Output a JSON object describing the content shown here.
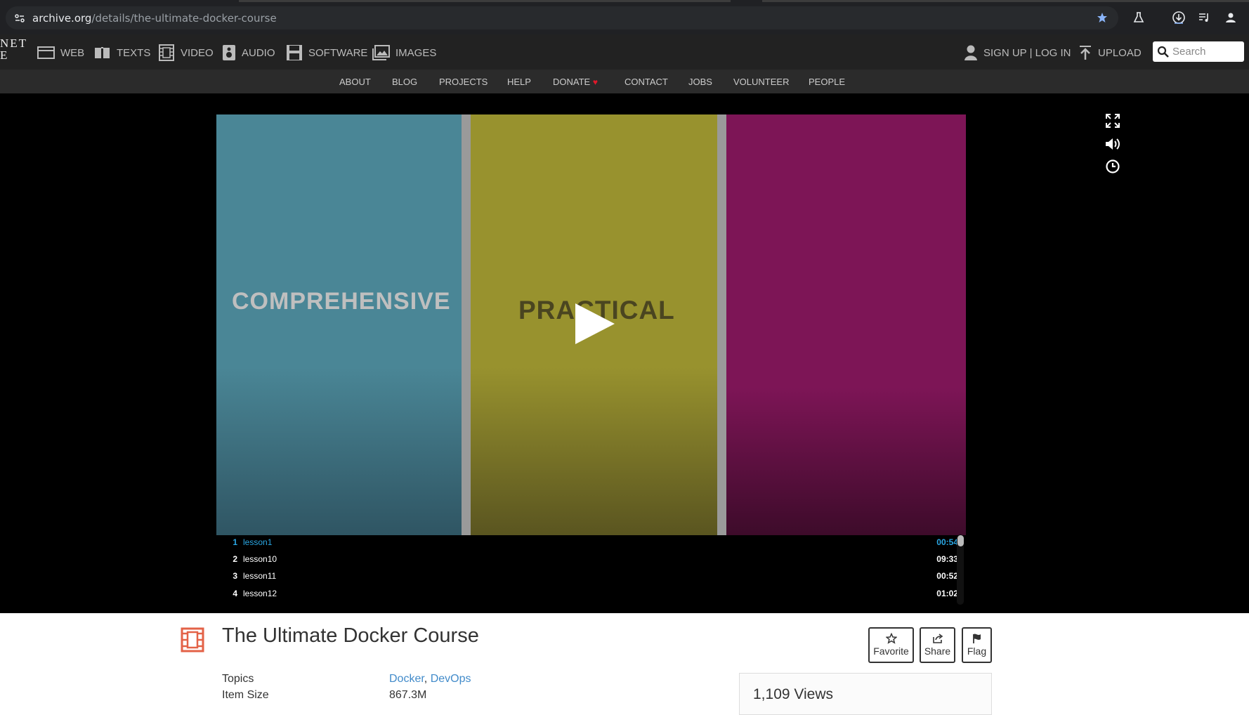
{
  "browser": {
    "url_domain": "archive.org",
    "url_path": "/details/the-ultimate-docker-course",
    "icons": [
      "site-settings-icon",
      "bookmark-star-icon",
      "labs-flask-icon",
      "download-icon",
      "media-queue-icon",
      "profile-icon"
    ]
  },
  "ia_nav": {
    "logo_lines": [
      "NET",
      "E"
    ],
    "items": [
      {
        "label": "WEB",
        "icon": "web-icon"
      },
      {
        "label": "TEXTS",
        "icon": "book-icon"
      },
      {
        "label": "VIDEO",
        "icon": "film-icon"
      },
      {
        "label": "AUDIO",
        "icon": "speaker-icon"
      },
      {
        "label": "SOFTWARE",
        "icon": "floppy-icon"
      },
      {
        "label": "IMAGES",
        "icon": "image-icon"
      }
    ],
    "signup_label": "SIGN UP | LOG IN",
    "upload_label": "UPLOAD",
    "search_placeholder": "Search"
  },
  "sub_nav": {
    "items": [
      "ABOUT",
      "BLOG",
      "PROJECTS",
      "HELP",
      "DONATE",
      "CONTACT",
      "JOBS",
      "VOLUNTEER",
      "PEOPLE"
    ],
    "donate_heart": "♥"
  },
  "video": {
    "words": [
      "COMPREHENSIVE",
      "PRACTICAL"
    ],
    "colors": {
      "panel1": "#4a8696",
      "panel2": "#98922e",
      "panel3": "#7d1556",
      "active_track": "#2aa7e4"
    }
  },
  "playlist": [
    {
      "num": "1",
      "title": "lesson1",
      "duration": "00:54",
      "active": true
    },
    {
      "num": "2",
      "title": "lesson10",
      "duration": "09:33",
      "active": false
    },
    {
      "num": "3",
      "title": "lesson11",
      "duration": "00:52",
      "active": false
    },
    {
      "num": "4",
      "title": "lesson12",
      "duration": "01:02",
      "active": false
    }
  ],
  "item": {
    "title": "The Ultimate Docker Course",
    "actions": {
      "favorite": "Favorite",
      "share": "Share",
      "flag": "Flag"
    },
    "topics_label": "Topics",
    "topics": [
      "Docker",
      "DevOps"
    ],
    "topics_sep": ",",
    "size_label": "Item Size",
    "size_value": "867.3M",
    "views": "1,109 Views"
  }
}
